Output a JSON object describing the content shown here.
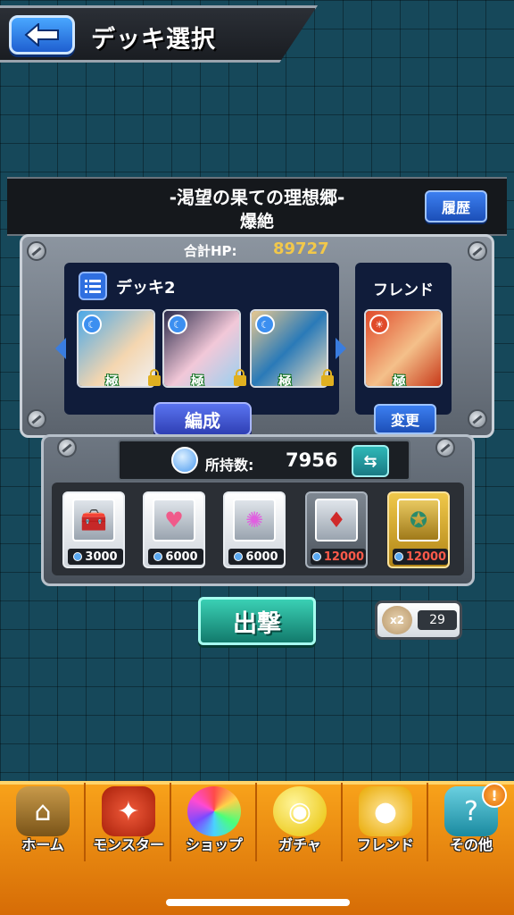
{
  "header": {
    "title": "デッキ選択"
  },
  "quest": {
    "name": "-渇望の果ての理想郷-",
    "difficulty": "爆絶",
    "history_label": "履歴"
  },
  "deck": {
    "total_hp_label": "合計HP:",
    "total_hp": "89727",
    "deck_name": "デッキ2",
    "edit_label": "編成",
    "monsters": [
      {
        "rank": "極",
        "element": "water"
      },
      {
        "rank": "極",
        "element": "water"
      },
      {
        "rank": "極",
        "element": "water"
      }
    ],
    "friend": {
      "label": "フレンド",
      "rank": "極",
      "element": "fire",
      "change_label": "変更"
    }
  },
  "items": {
    "owned_label": "所持数:",
    "owned_count": "7956",
    "list": [
      {
        "cost": "3000",
        "icon": "treasure-chest"
      },
      {
        "cost": "6000",
        "icon": "heart-plus"
      },
      {
        "cost": "6000",
        "icon": "sparkle-orb"
      },
      {
        "cost": "12000",
        "icon": "red-gem"
      },
      {
        "cost": "12000",
        "icon": "compass-medal"
      }
    ]
  },
  "sortie": {
    "label": "出撃"
  },
  "bonus": {
    "multiplier": "x2",
    "count": "29"
  },
  "nav": {
    "items": [
      {
        "label": "ホーム"
      },
      {
        "label": "モンスター"
      },
      {
        "label": "ショップ"
      },
      {
        "label": "ガチャ"
      },
      {
        "label": "フレンド"
      },
      {
        "label": "その他"
      }
    ],
    "notice": "!"
  },
  "colors": {
    "background": "#16485a",
    "accent_blue": "#2f6fe0",
    "nav_orange": "#f8a21a",
    "cost_red": "#ff5a4a",
    "hp_gold": "#f2c84a"
  }
}
